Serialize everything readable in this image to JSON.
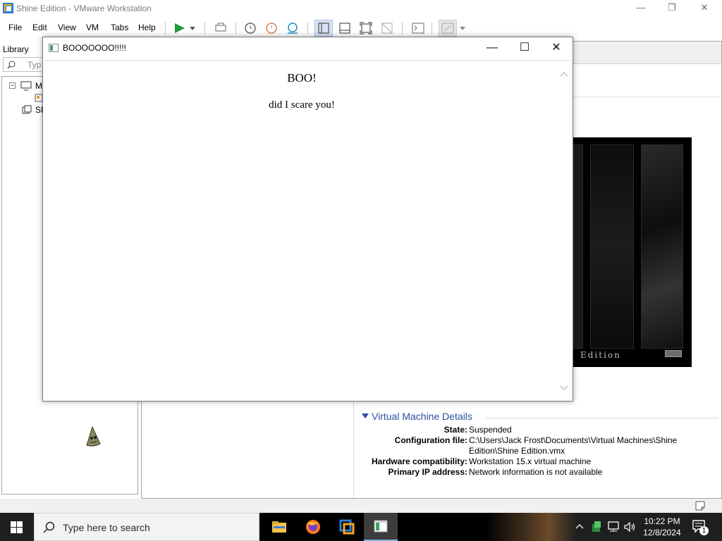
{
  "window": {
    "title": "Shine Edition - VMware Workstation",
    "controls": {
      "minimize": "—",
      "restore": "❐",
      "close": "✕"
    }
  },
  "menu": {
    "items": [
      "File",
      "Edit",
      "View",
      "VM",
      "Tabs",
      "Help"
    ]
  },
  "library": {
    "label": "Library",
    "search_placeholder": "Typ",
    "tree": [
      {
        "label": "M"
      },
      {
        "label": "SH"
      }
    ]
  },
  "vm_details": {
    "header": "Virtual Machine Details",
    "rows": [
      {
        "label": "State:",
        "value": "Suspended"
      },
      {
        "label": "Configuration file:",
        "value": "C:\\Users\\Jack Frost\\Documents\\Virtual Machines\\Shine Edition\\Shine Edition.vmx"
      },
      {
        "label": "Hardware compatibility:",
        "value": "Workstation 15.x virtual machine"
      },
      {
        "label": "Primary IP address:",
        "value": "Network information is not available"
      }
    ],
    "preview_text": "Edition"
  },
  "popup": {
    "title": "BOOOOOOO!!!!!",
    "heading": "BOO!",
    "message": "did I scare you!",
    "controls": {
      "minimize": "—",
      "maximize": "☐",
      "close": "✕"
    }
  },
  "taskbar": {
    "search_placeholder": "Type here to search",
    "clock": {
      "time": "10:22 PM",
      "date": "12/8/2024"
    },
    "notification_count": "1"
  },
  "colors": {
    "accent": "#2a4f9e",
    "taskbar": "#1f1f1f",
    "play_green": "#1e9b3a"
  }
}
